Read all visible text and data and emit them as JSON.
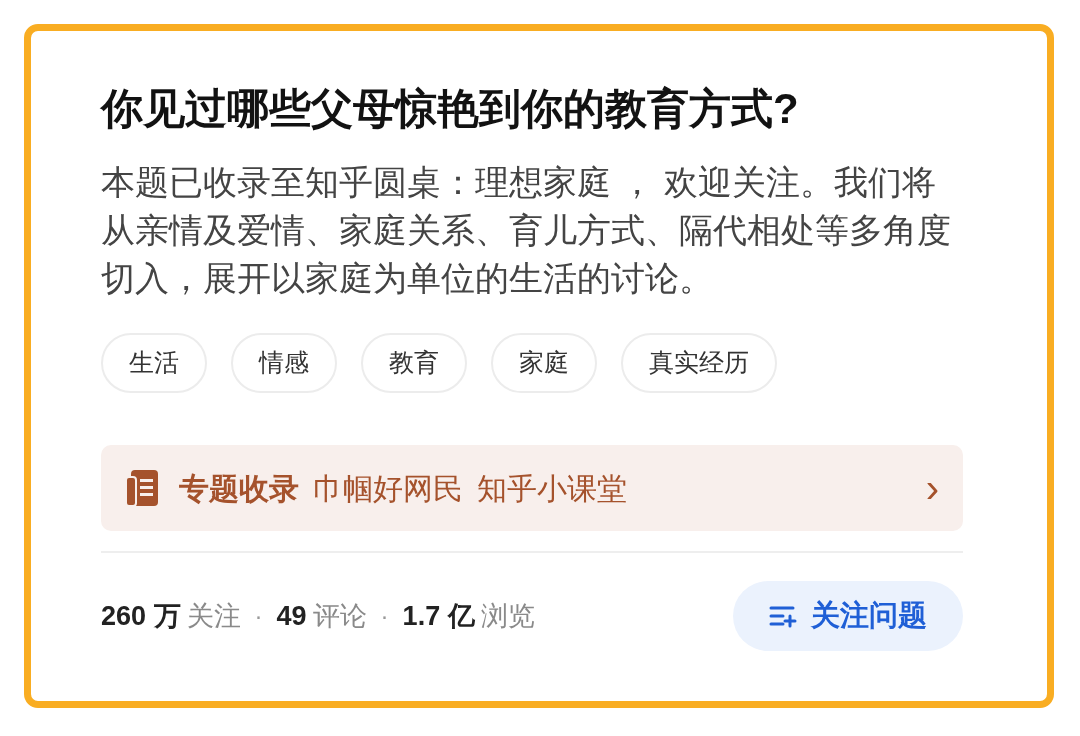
{
  "title": "你见过哪些父母惊艳到你的教育方式?",
  "description": "本题已收录至知乎圆桌：理想家庭 ， 欢迎关注。我们将从亲情及爱情、家庭关系、育儿方式、隔代相处等多角度切入，展开以家庭为单位的生活的讨论。",
  "tags": [
    "生活",
    "情感",
    "教育",
    "家庭",
    "真实经历"
  ],
  "collection": {
    "label": "专题收录",
    "items": [
      "巾帼好网民",
      "知乎小课堂"
    ],
    "arrow": "›"
  },
  "stats": [
    {
      "count": "260 万",
      "noun": "关注"
    },
    {
      "separator": "·",
      "count": "49",
      "noun": "评论"
    },
    {
      "separator": "·",
      "count": "1.7 亿",
      "noun": "浏览"
    }
  ],
  "follow_button": {
    "label": "关注问题"
  }
}
